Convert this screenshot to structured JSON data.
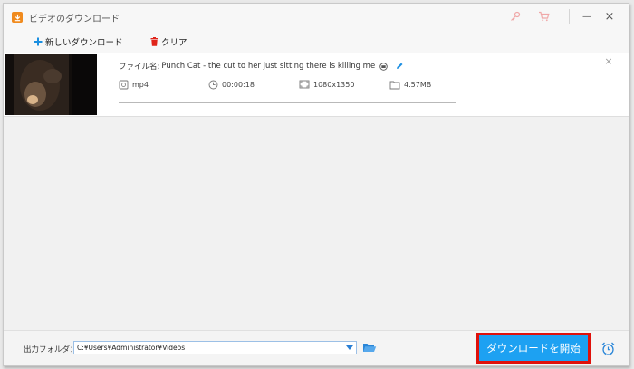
{
  "window": {
    "title": "ビデオのダウンロード",
    "icons": [
      "download-icon",
      "key-icon",
      "cart-icon",
      "minimize-icon",
      "close-icon"
    ],
    "minimize_glyph": "—",
    "close_glyph": "×"
  },
  "toolbar": {
    "new_download_label": "新しいダウンロード",
    "new_download_icon": "plus-icon",
    "clear_label": "クリア",
    "clear_icon": "trash-icon"
  },
  "download_item": {
    "filename_label": "ファイル名:",
    "filename": "Punch Cat - the cut to her just sitting there is killing me",
    "format": "mp4",
    "duration": "00:00:18",
    "resolution": "1080x1350",
    "size": "4.57MB",
    "progress": 1.0,
    "icons": [
      "format-icon",
      "clock-icon",
      "resolution-icon",
      "filesize-icon",
      "subtitle-icon",
      "edit-icon"
    ],
    "close_glyph": "×"
  },
  "bottom": {
    "folder_label": "出力フォルダ：",
    "folder_path": "C:¥Users¥Administrator¥Videos",
    "start_button": "ダウンロードを開始",
    "icons": [
      "dropdown-arrow-icon",
      "open-folder-icon",
      "alarm-clock-icon"
    ]
  },
  "colors": {
    "accent": "#1da1f2",
    "highlight_border": "#e0110b",
    "app_icon": "#f08a1d",
    "plus": "#1b8fe0",
    "trash": "#e0241a"
  }
}
